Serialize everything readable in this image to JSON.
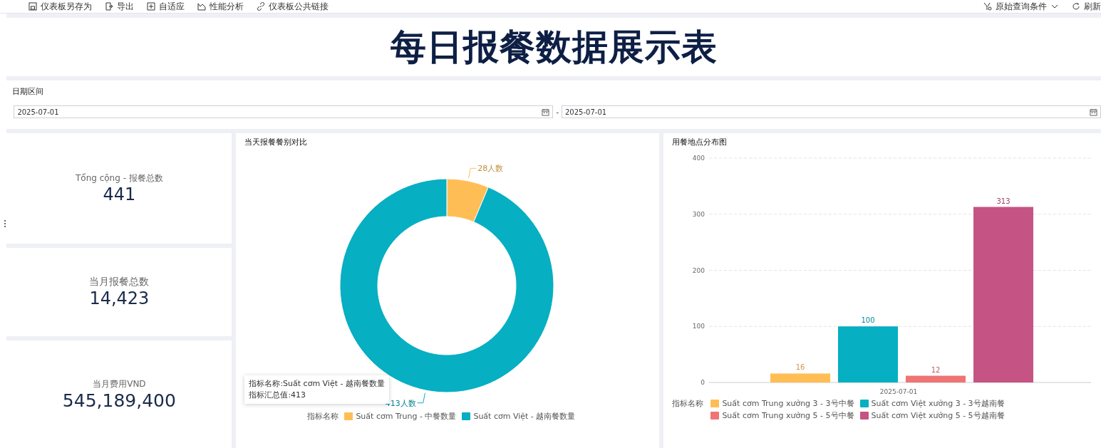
{
  "toolbar": {
    "left": [
      {
        "label": "仪表板另存为"
      },
      {
        "label": "导出"
      },
      {
        "label": "自适应"
      },
      {
        "label": "性能分析"
      },
      {
        "label": "仪表板公共链接"
      }
    ],
    "right": [
      {
        "label": "原始查询条件"
      },
      {
        "label": "刷新"
      }
    ]
  },
  "title": "每日报餐数据展示表",
  "filter": {
    "label": "日期区间",
    "start": "2025-07-01",
    "separator": "-",
    "end": "2025-07-01"
  },
  "kpis": [
    {
      "label": "Tổng cộng - 报餐总数",
      "value": "441"
    },
    {
      "label": "当月报餐总数",
      "value": "14,423"
    },
    {
      "label": "当月费用VND",
      "value": "545,189,400"
    }
  ],
  "donut": {
    "title": "当天报餐餐别对比",
    "chart_data": {
      "type": "donut",
      "legend_title": "指标名称",
      "categories": [
        "Suất cơm Trung - 中餐数量",
        "Suất cơm Việt - 越南餐数量"
      ],
      "colors": [
        "#ffbe55",
        "#06afc2"
      ],
      "values": [
        28,
        413
      ],
      "value_labels": [
        "28人数",
        "413人数"
      ]
    },
    "tooltip": {
      "lines": [
        "指标名称:Suất cơm Việt - 越南餐数量",
        "指标汇总值:413"
      ]
    }
  },
  "bar": {
    "title": "用餐地点分布图",
    "chart_data": {
      "type": "bar",
      "legend_title": "指标名称",
      "categories": [
        "2025-07-01"
      ],
      "grid": true,
      "ylim": [
        0,
        400
      ],
      "yticks": [
        0,
        100,
        200,
        300,
        400
      ],
      "data_labels": true,
      "series": [
        {
          "name": "Suất cơm Trung xưởng 3 - 3号中餐",
          "color": "#ffbe55",
          "values": [
            16
          ]
        },
        {
          "name": "Suất cơm Việt xưởng 3 - 3号越南餐",
          "color": "#06afc2",
          "values": [
            100
          ]
        },
        {
          "name": "Suất cơm Trung xưởng 5 - 5号中餐",
          "color": "#f07474",
          "values": [
            12
          ]
        },
        {
          "name": "Suất cơm Việt xưởng 5 - 5号越南餐",
          "color": "#c55484",
          "values": [
            313
          ]
        }
      ]
    }
  }
}
